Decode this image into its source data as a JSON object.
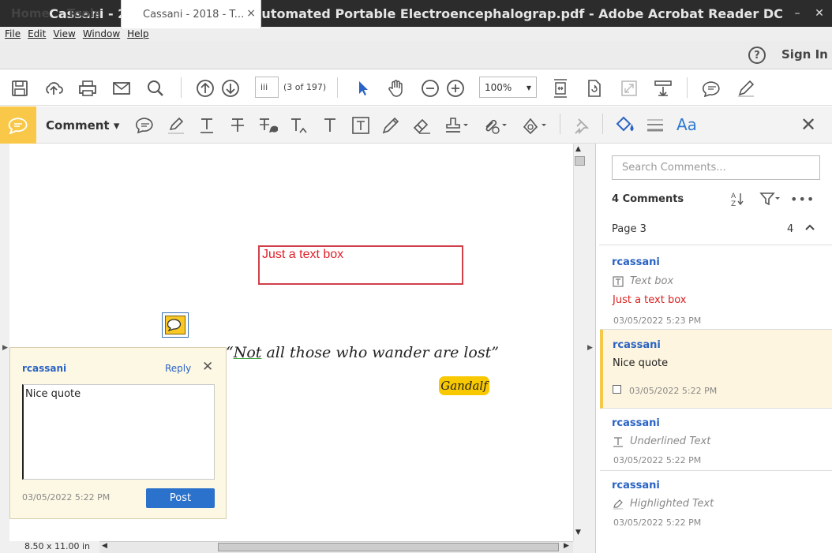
{
  "window": {
    "title": "Cassani - 2018 - Towards an Automated Portable Electroencephalograp.pdf - Adobe Acrobat Reader DC",
    "controls": {
      "minimize": "–",
      "close": "✕"
    }
  },
  "menu": {
    "items": [
      "File",
      "Edit",
      "View",
      "Window",
      "Help"
    ]
  },
  "tabs": {
    "home": "Home",
    "tools": "Tools",
    "document": "Cassani - 2018 - T...",
    "close": "×"
  },
  "header": {
    "help": "?",
    "sign_in": "Sign In"
  },
  "toolbar": {
    "page_input": "iii",
    "page_count": "(3 of 197)",
    "zoom": "100%"
  },
  "comment_bar": {
    "label": "Comment ▾",
    "text_format": "Aa",
    "accent_color": "#f9c848"
  },
  "document": {
    "page_size": "8.50 x 11.00 in",
    "text_box": "Just a text box",
    "quote_open": "“",
    "quote_underlined": "Not",
    "quote_rest": " all those who wander are lost”",
    "highlighted": "Gandalf"
  },
  "popup": {
    "author": "rcassani",
    "reply": "Reply",
    "text": "Nice quote",
    "date": "03/05/2022  5:22 PM",
    "post": "Post"
  },
  "panel": {
    "search_placeholder": "Search Comments...",
    "count": "4 Comments",
    "page_label": "Page 3",
    "page_count": "4",
    "comments": [
      {
        "author": "rcassani",
        "kind": "Text box",
        "body": "Just a text box",
        "date": "03/05/2022  5:23 PM"
      },
      {
        "author": "rcassani",
        "body": "Nice quote",
        "date": "03/05/2022  5:22 PM"
      },
      {
        "author": "rcassani",
        "kind": "Underlined Text",
        "date": "03/05/2022  5:22 PM"
      },
      {
        "author": "rcassani",
        "kind": "Highlighted Text",
        "date": "03/05/2022  5:22 PM"
      }
    ]
  }
}
